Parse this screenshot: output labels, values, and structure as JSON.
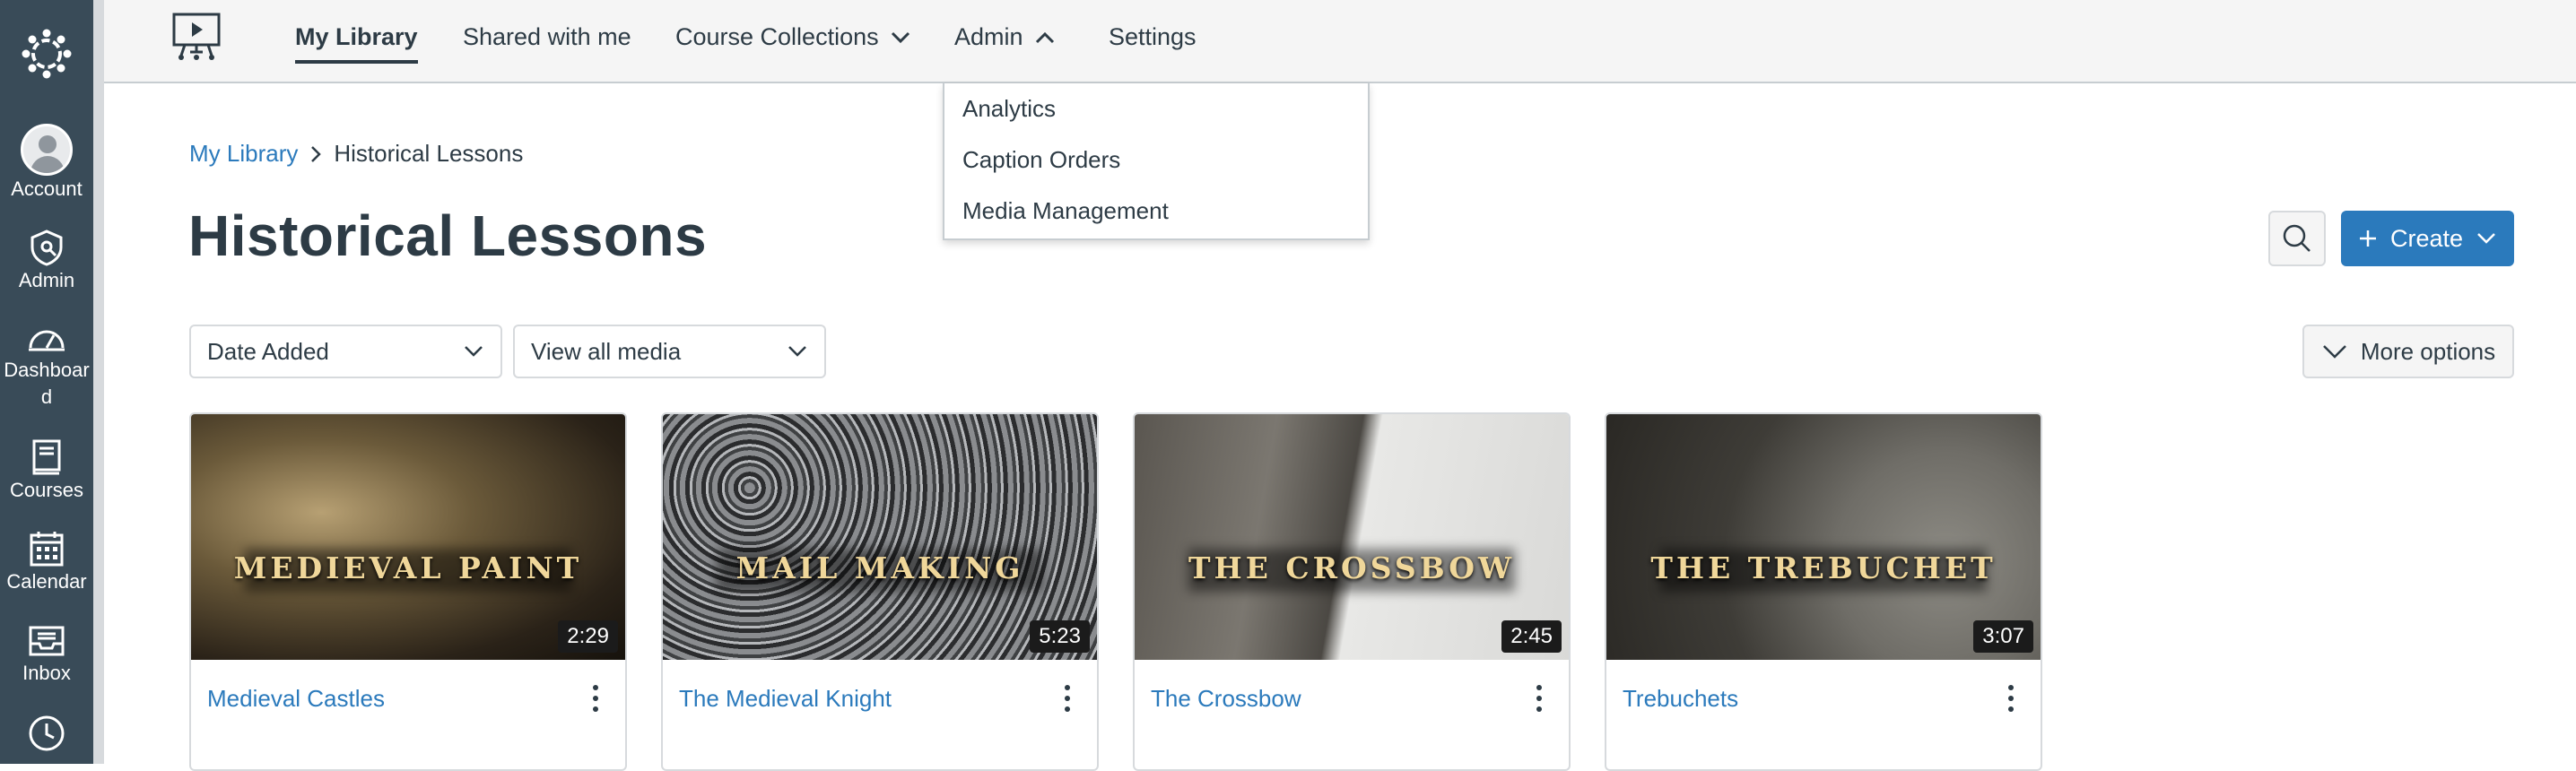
{
  "global_nav": {
    "items": [
      {
        "label": "Account"
      },
      {
        "label": "Admin"
      },
      {
        "label": "Dashboard"
      },
      {
        "label": "Courses"
      },
      {
        "label": "Calendar"
      },
      {
        "label": "Inbox"
      }
    ]
  },
  "top_nav": {
    "tabs": [
      {
        "label": "My Library"
      },
      {
        "label": "Shared with me"
      },
      {
        "label": "Course Collections"
      },
      {
        "label": "Admin"
      },
      {
        "label": "Settings"
      }
    ]
  },
  "admin_menu": {
    "items": [
      {
        "label": "Analytics"
      },
      {
        "label": "Caption Orders"
      },
      {
        "label": "Media Management"
      }
    ]
  },
  "breadcrumb": {
    "root": "My Library",
    "current": "Historical Lessons"
  },
  "page": {
    "title": "Historical Lessons",
    "create_label": "Create",
    "sort_value": "Date Added",
    "filter_value": "View all media",
    "more_options_label": "More options"
  },
  "media": [
    {
      "thumb_title": "MEDIEVAL PAINT",
      "duration": "2:29",
      "title": "Medieval Castles"
    },
    {
      "thumb_title": "MAIL MAKING",
      "duration": "5:23",
      "title": "The Medieval Knight"
    },
    {
      "thumb_title": "THE CROSSBOW",
      "duration": "2:45",
      "title": "The Crossbow"
    },
    {
      "thumb_title": "THE TREBUCHET",
      "duration": "3:07",
      "title": "Trebuchets"
    }
  ],
  "colors": {
    "nav_bg": "#394b58",
    "link": "#2b7abc",
    "primary_button": "#2b7abc",
    "text": "#2d3b45"
  }
}
